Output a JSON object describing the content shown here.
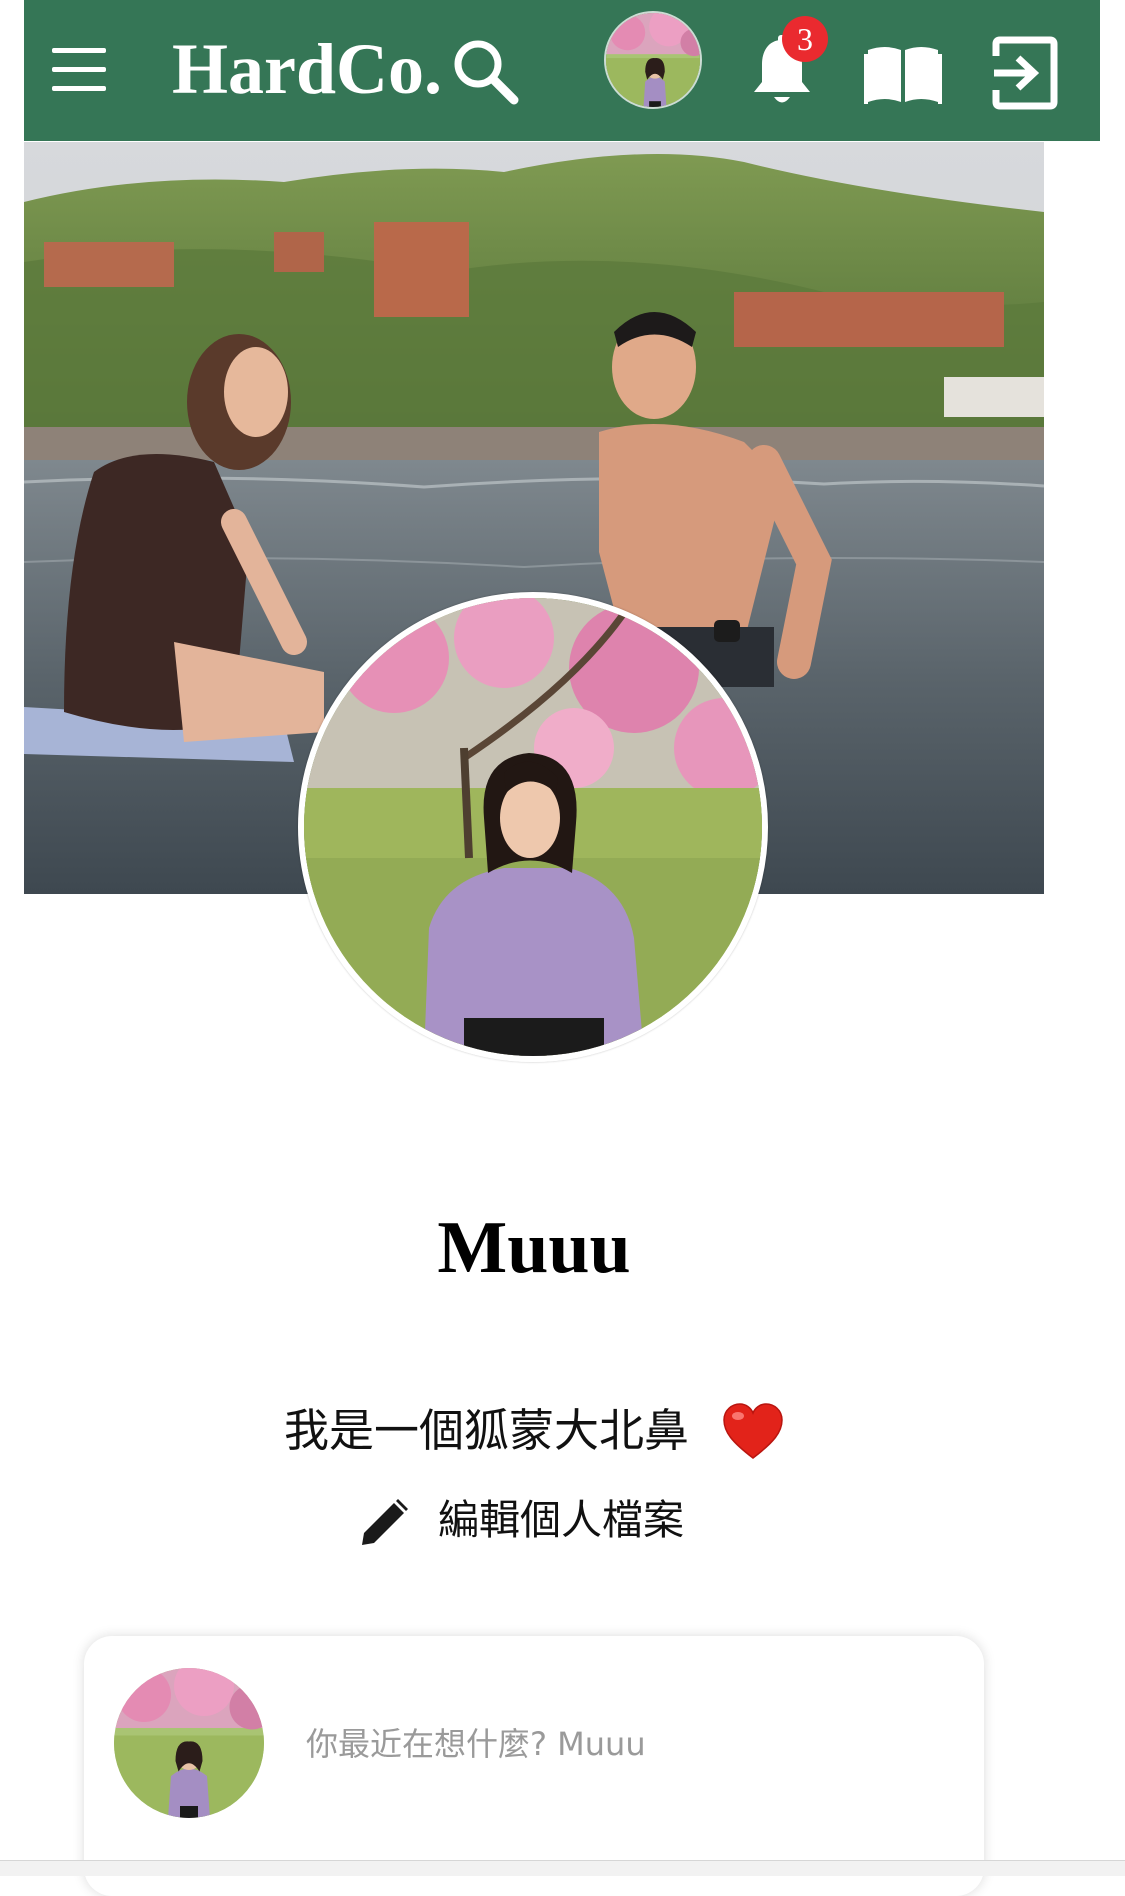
{
  "app": {
    "logo_text": "HardCo."
  },
  "header": {
    "notification_count": "3"
  },
  "icons": {
    "menu": "menu-icon",
    "search": "search-icon",
    "notifications": "bell-icon",
    "docs": "book-icon",
    "logout": "logout-icon",
    "edit": "pencil-icon",
    "bio_emoji": "heart-icon"
  },
  "profile": {
    "name": "Muuu",
    "bio": "我是一個狐蒙大北鼻",
    "edit_label": "編輯個人檔案"
  },
  "composer": {
    "placeholder": "你最近在想什麼? Muuu"
  },
  "colors": {
    "topbar": "#357656",
    "badge": "#ea2a2f",
    "heart": "#e2231a"
  }
}
